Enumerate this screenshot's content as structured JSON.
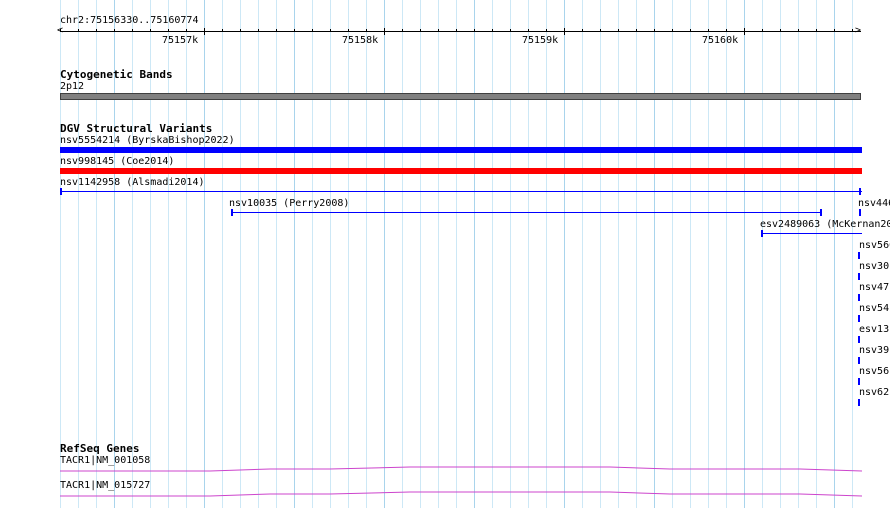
{
  "ruler": {
    "locus": "chr2:75156330..75160774",
    "labels": [
      "75157k",
      "75158k",
      "75159k",
      "75160k"
    ]
  },
  "cytobands": {
    "title": "Cytogenetic Bands",
    "band": "2p12",
    "color": "#808080"
  },
  "dgv": {
    "title": "DGV Structural Variants",
    "features": [
      {
        "label": "nsv5554214 (ByrskaBishop2022)",
        "color": "#0000ff",
        "style": "bar"
      },
      {
        "label": "nsv998145 (Coe2014)",
        "color": "#ff0000",
        "style": "bar"
      },
      {
        "label": "nsv1142958 (Alsmadi2014)",
        "color": "#0000ff",
        "style": "line"
      },
      {
        "label": "nsv10035 (Perry2008)",
        "color": "#0000ff",
        "style": "line"
      },
      {
        "label": "nsv446",
        "color": "#0000ff",
        "style": "tick"
      },
      {
        "label": "esv2489063 (McKernan20",
        "color": "#0000ff",
        "style": "line"
      },
      {
        "label": "nsv560",
        "color": "#0000ff",
        "style": "tick"
      },
      {
        "label": "nsv30",
        "color": "#0000ff",
        "style": "tick"
      },
      {
        "label": "nsv47",
        "color": "#0000ff",
        "style": "tick"
      },
      {
        "label": "nsv54",
        "color": "#0000ff",
        "style": "tick"
      },
      {
        "label": "esv13",
        "color": "#0000ff",
        "style": "tick"
      },
      {
        "label": "nsv39",
        "color": "#0000ff",
        "style": "tick"
      },
      {
        "label": "nsv56",
        "color": "#0000ff",
        "style": "tick"
      },
      {
        "label": "nsv62",
        "color": "#0000ff",
        "style": "tick"
      }
    ]
  },
  "refseq": {
    "title": "RefSeq Genes",
    "color": "#cc44cc",
    "genes": [
      {
        "label": "TACR1|NM_001058"
      },
      {
        "label": "TACR1|NM_015727"
      }
    ]
  }
}
